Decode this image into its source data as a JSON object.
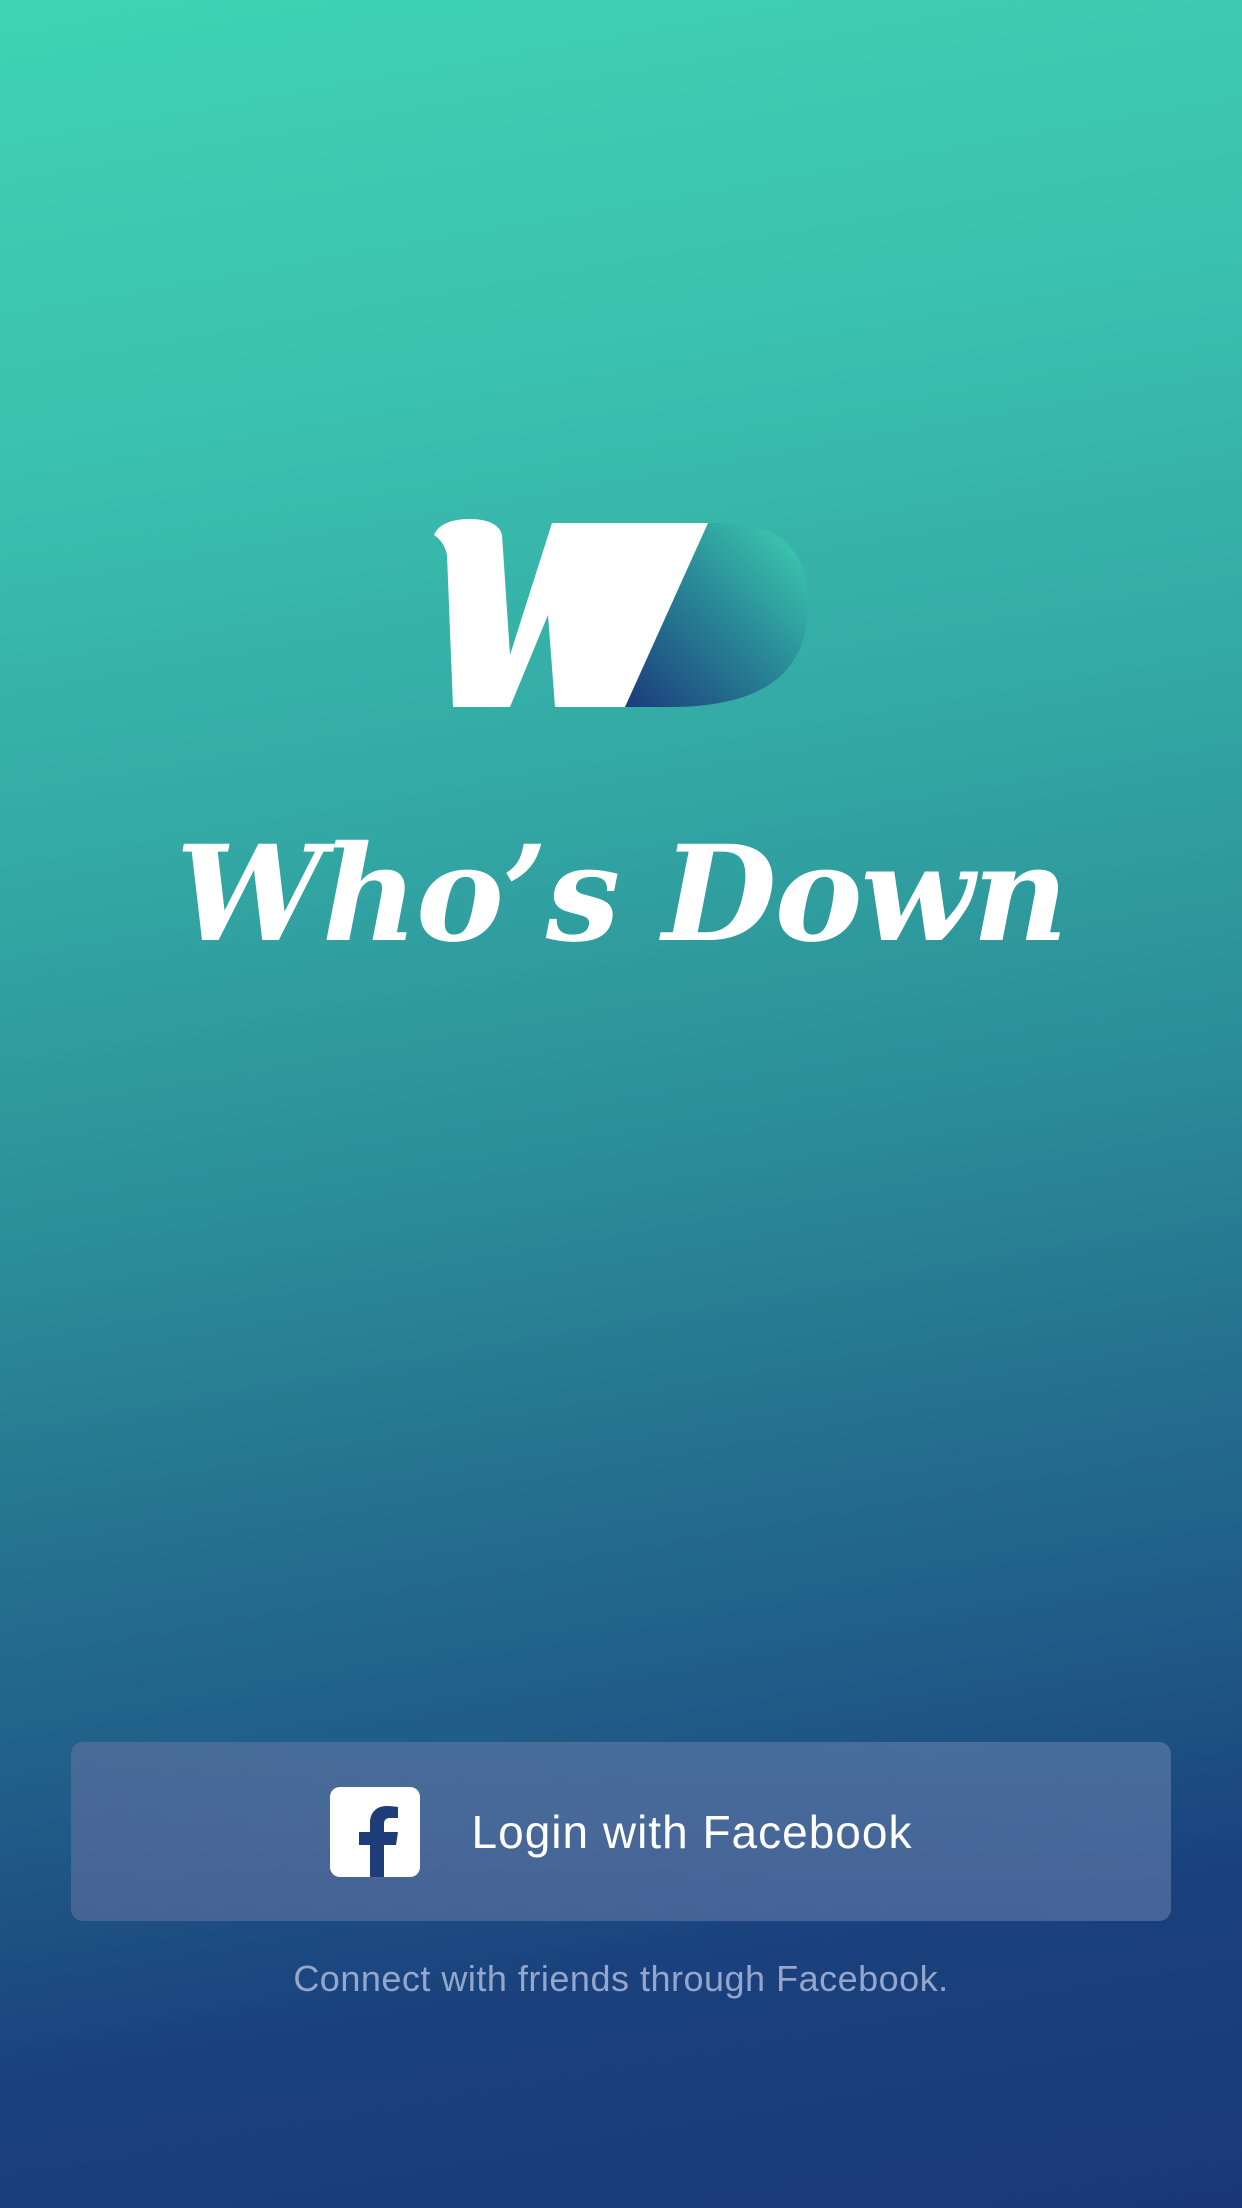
{
  "app": {
    "name": "Who’s Down",
    "logo_icon": "wd-logo-icon"
  },
  "login": {
    "button_label": "Login with Facebook",
    "icon": "facebook-icon",
    "subtext": "Connect with friends through Facebook."
  },
  "colors": {
    "gradient_top": "#3fd3b3",
    "gradient_bottom": "#1a3878",
    "logo_accent_dark": "#1b3a7c",
    "logo_accent_light": "#3fd3b3",
    "text": "#ffffff"
  }
}
